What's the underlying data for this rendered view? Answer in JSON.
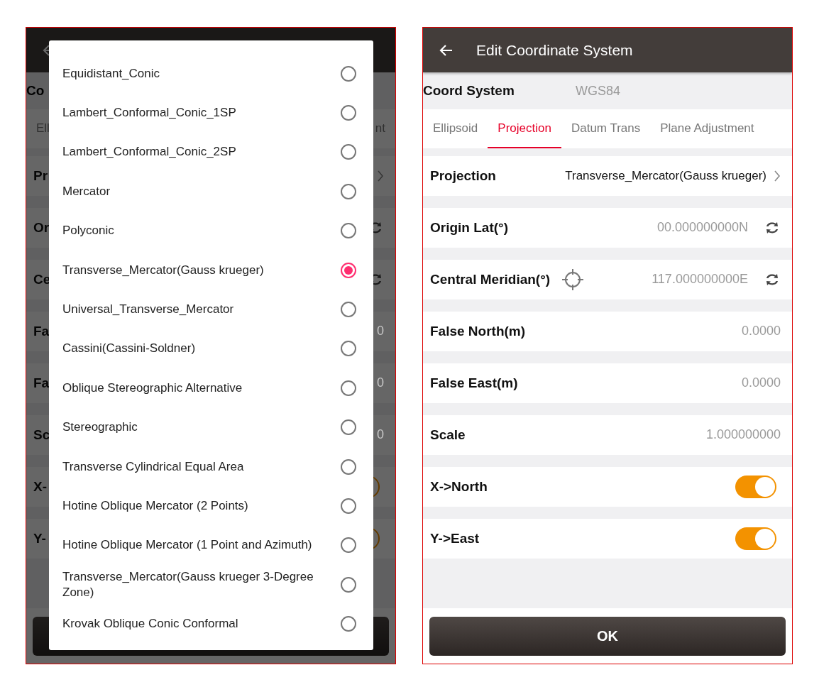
{
  "left_screen": {
    "background": {
      "coord_label": "Co",
      "tabs": [
        {
          "label": "Ell",
          "selected": false
        },
        {
          "label": "nt",
          "selected": false
        }
      ],
      "rows": [
        {
          "kind": "chevron",
          "label": "Pr"
        },
        {
          "kind": "swap",
          "label": "Or"
        },
        {
          "kind": "swap",
          "label": "Ce"
        },
        {
          "kind": "value",
          "label": "Fa",
          "value": "0"
        },
        {
          "kind": "value",
          "label": "Fa",
          "value": "0"
        },
        {
          "kind": "value",
          "label": "Sc",
          "value": "0"
        },
        {
          "kind": "toggle",
          "label": "X-",
          "on": true
        },
        {
          "kind": "toggle",
          "label": "Y-",
          "on": true
        }
      ]
    },
    "dialog": {
      "options": [
        {
          "label": "Equidistant_Conic",
          "selected": false
        },
        {
          "label": "Lambert_Conformal_Conic_1SP",
          "selected": false
        },
        {
          "label": "Lambert_Conformal_Conic_2SP",
          "selected": false
        },
        {
          "label": "Mercator",
          "selected": false
        },
        {
          "label": "Polyconic",
          "selected": false
        },
        {
          "label": "Transverse_Mercator(Gauss krueger)",
          "selected": true
        },
        {
          "label": "Universal_Transverse_Mercator",
          "selected": false
        },
        {
          "label": "Cassini(Cassini-Soldner)",
          "selected": false
        },
        {
          "label": "Oblique Stereographic Alternative",
          "selected": false
        },
        {
          "label": "Stereographic",
          "selected": false
        },
        {
          "label": "Transverse Cylindrical Equal Area",
          "selected": false
        },
        {
          "label": "Hotine Oblique Mercator (2 Points)",
          "selected": false
        },
        {
          "label": "Hotine Oblique Mercator (1 Point and Azimuth)",
          "selected": false
        },
        {
          "label": "Transverse_Mercator(Gauss krueger 3-Degree Zone)",
          "selected": false
        },
        {
          "label": "Krovak Oblique Conic Conformal",
          "selected": false
        }
      ]
    }
  },
  "right_screen": {
    "title": "Edit Coordinate System",
    "coord_system": {
      "label": "Coord System",
      "value": "WGS84"
    },
    "tabs": [
      {
        "label": "Ellipsoid",
        "selected": false
      },
      {
        "label": "Projection",
        "selected": true
      },
      {
        "label": "Datum Trans",
        "selected": false
      },
      {
        "label": "Plane Adjustment",
        "selected": false
      }
    ],
    "rows": [
      {
        "kind": "chevron",
        "label": "Projection",
        "value": "Transverse_Mercator(Gauss krueger)"
      },
      {
        "kind": "swap",
        "label": "Origin Lat(°)",
        "value": "00.000000000N"
      },
      {
        "kind": "swap",
        "label": "Central Meridian(°)",
        "value": "117.000000000E",
        "target": true
      },
      {
        "kind": "value",
        "label": "False North(m)",
        "value": "0.0000"
      },
      {
        "kind": "value",
        "label": "False East(m)",
        "value": "0.0000"
      },
      {
        "kind": "value",
        "label": "Scale",
        "value": "1.000000000"
      },
      {
        "kind": "toggle",
        "label": "X->North",
        "on": true
      },
      {
        "kind": "toggle",
        "label": "Y->East",
        "on": true
      }
    ],
    "ok_button": "OK"
  }
}
